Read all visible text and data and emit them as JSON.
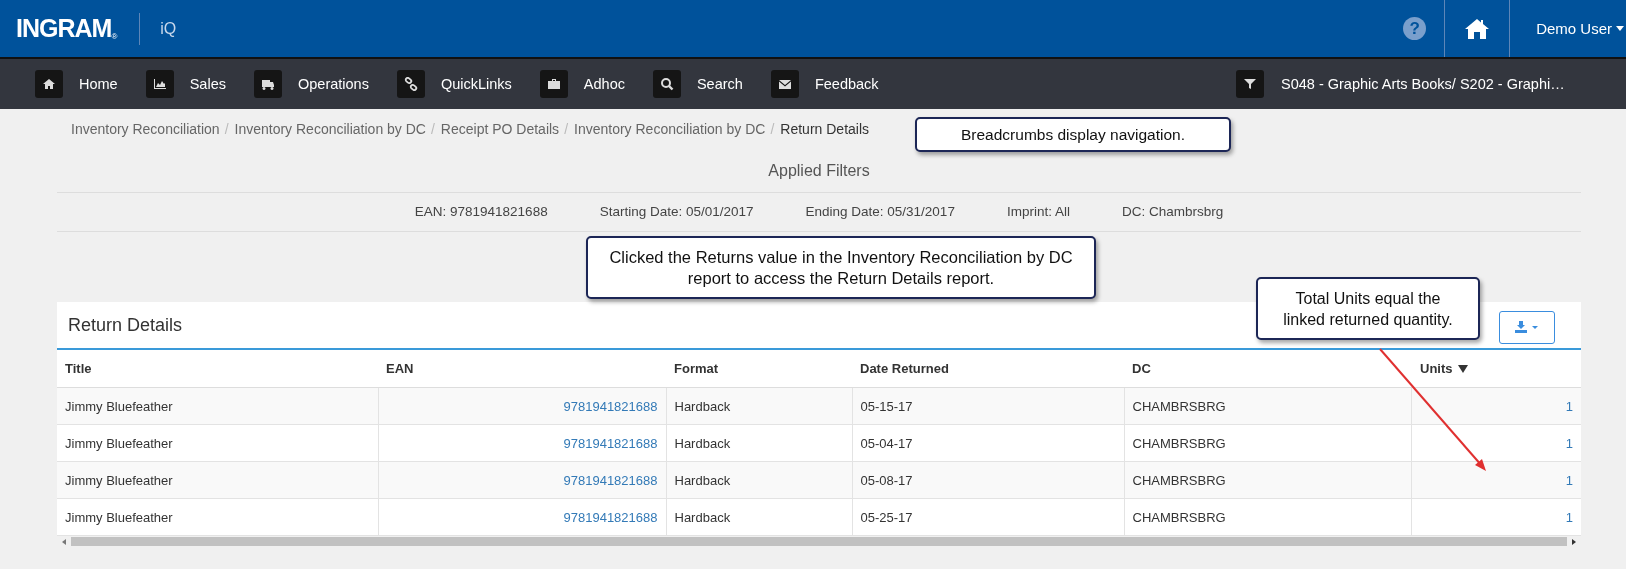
{
  "header": {
    "brand": "INGRAM",
    "brand_mark": "®",
    "product": "iQ",
    "help": "?",
    "user": "Demo User"
  },
  "nav": {
    "items": [
      {
        "label": "Home"
      },
      {
        "label": "Sales"
      },
      {
        "label": "Operations"
      },
      {
        "label": "QuickLinks"
      },
      {
        "label": "Adhoc"
      },
      {
        "label": "Search"
      },
      {
        "label": "Feedback"
      }
    ],
    "filter_label": "S048 - Graphic Arts Books/ S202 - Graphi…"
  },
  "breadcrumbs": [
    {
      "label": "Inventory Reconciliation",
      "current": false
    },
    {
      "label": "Inventory Reconciliation by DC",
      "current": false
    },
    {
      "label": "Receipt PO Details",
      "current": false
    },
    {
      "label": "Inventory Reconciliation by DC",
      "current": false
    },
    {
      "label": "Return Details",
      "current": true
    }
  ],
  "breadcrumb_separator": "/",
  "applied_filters": {
    "title": "Applied Filters",
    "items": [
      "EAN: 9781941821688",
      "Starting Date: 05/01/2017",
      "Ending Date: 05/31/2017",
      "Imprint: All",
      "DC: Chambrsbrg"
    ]
  },
  "report": {
    "title": "Return Details",
    "columns": [
      {
        "label": "Title",
        "sorted": false
      },
      {
        "label": "EAN",
        "sorted": false
      },
      {
        "label": "Format",
        "sorted": false
      },
      {
        "label": "Date Returned",
        "sorted": false
      },
      {
        "label": "DC",
        "sorted": false
      },
      {
        "label": "Units",
        "sorted": true
      }
    ],
    "rows": [
      {
        "cells": [
          "Jimmy Bluefeather",
          "9781941821688",
          "Hardback",
          "05-15-17",
          "CHAMBRSBRG",
          "1"
        ]
      },
      {
        "cells": [
          "Jimmy Bluefeather",
          "9781941821688",
          "Hardback",
          "05-04-17",
          "CHAMBRSBRG",
          "1"
        ]
      },
      {
        "cells": [
          "Jimmy Bluefeather",
          "9781941821688",
          "Hardback",
          "05-08-17",
          "CHAMBRSBRG",
          "1"
        ]
      },
      {
        "cells": [
          "Jimmy Bluefeather",
          "9781941821688",
          "Hardback",
          "05-25-17",
          "CHAMBRSBRG",
          "1"
        ]
      }
    ]
  },
  "callouts": [
    {
      "kind": "breadcrumbs",
      "text": "Breadcrumbs display navigation."
    },
    {
      "kind": "filters",
      "text": "Clicked the Returns value in the Inventory Reconciliation by DC report to access the Return Details report."
    },
    {
      "kind": "units",
      "text": "Total Units equal the linked returned quantity."
    }
  ]
}
